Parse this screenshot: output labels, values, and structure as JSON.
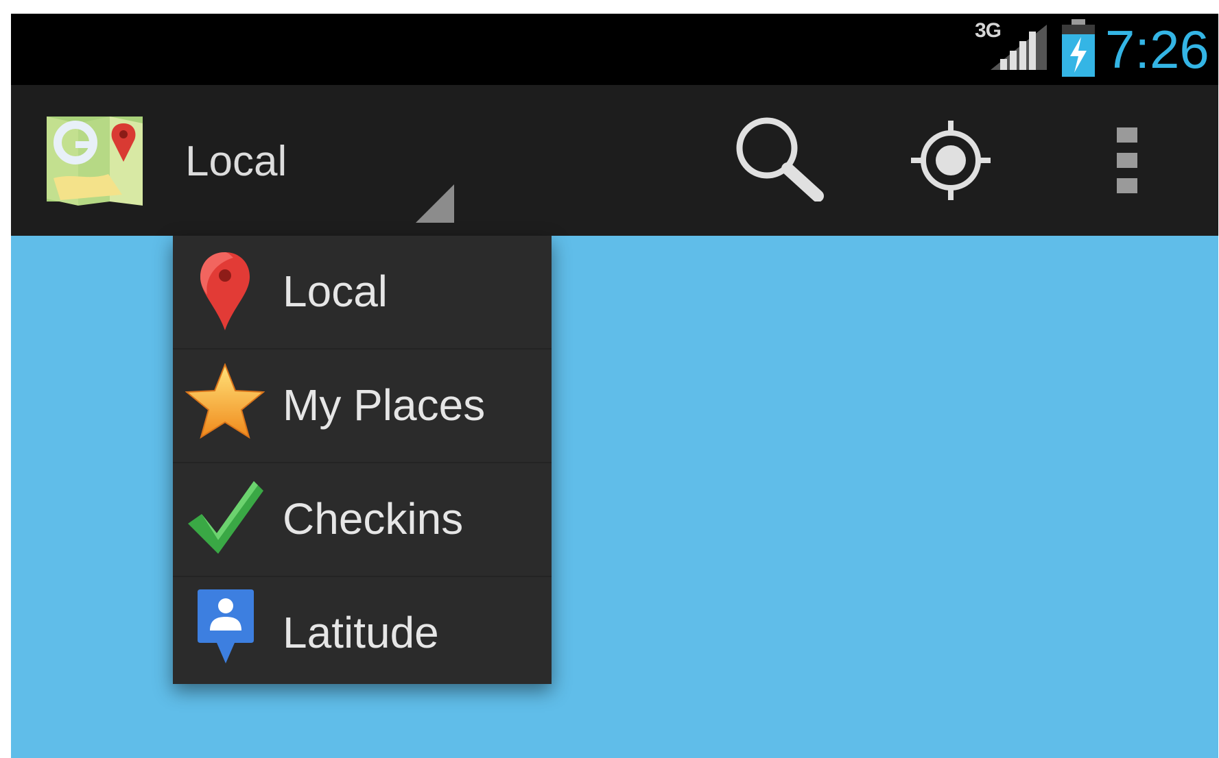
{
  "status_bar": {
    "network_label": "3G",
    "time": "7:26",
    "icons": [
      "signal-icon",
      "battery-charging-icon"
    ]
  },
  "action_bar": {
    "app_icon": "maps-app-icon",
    "nav_selected": "Local",
    "actions": [
      "search-icon",
      "my-location-icon",
      "overflow-menu-icon"
    ]
  },
  "dropdown": {
    "items": [
      {
        "label": "Local",
        "icon": "red-pin-icon"
      },
      {
        "label": "My Places",
        "icon": "star-icon"
      },
      {
        "label": "Checkins",
        "icon": "checkmark-icon"
      },
      {
        "label": "Latitude",
        "icon": "latitude-person-icon"
      }
    ]
  },
  "colors": {
    "status_bar_bg": "#000000",
    "action_bar_bg": "#1d1d1d",
    "dropdown_bg": "#2b2b2b",
    "map_bg": "#60bde9",
    "clock": "#34b5e5",
    "text": "#e6e6e6"
  }
}
